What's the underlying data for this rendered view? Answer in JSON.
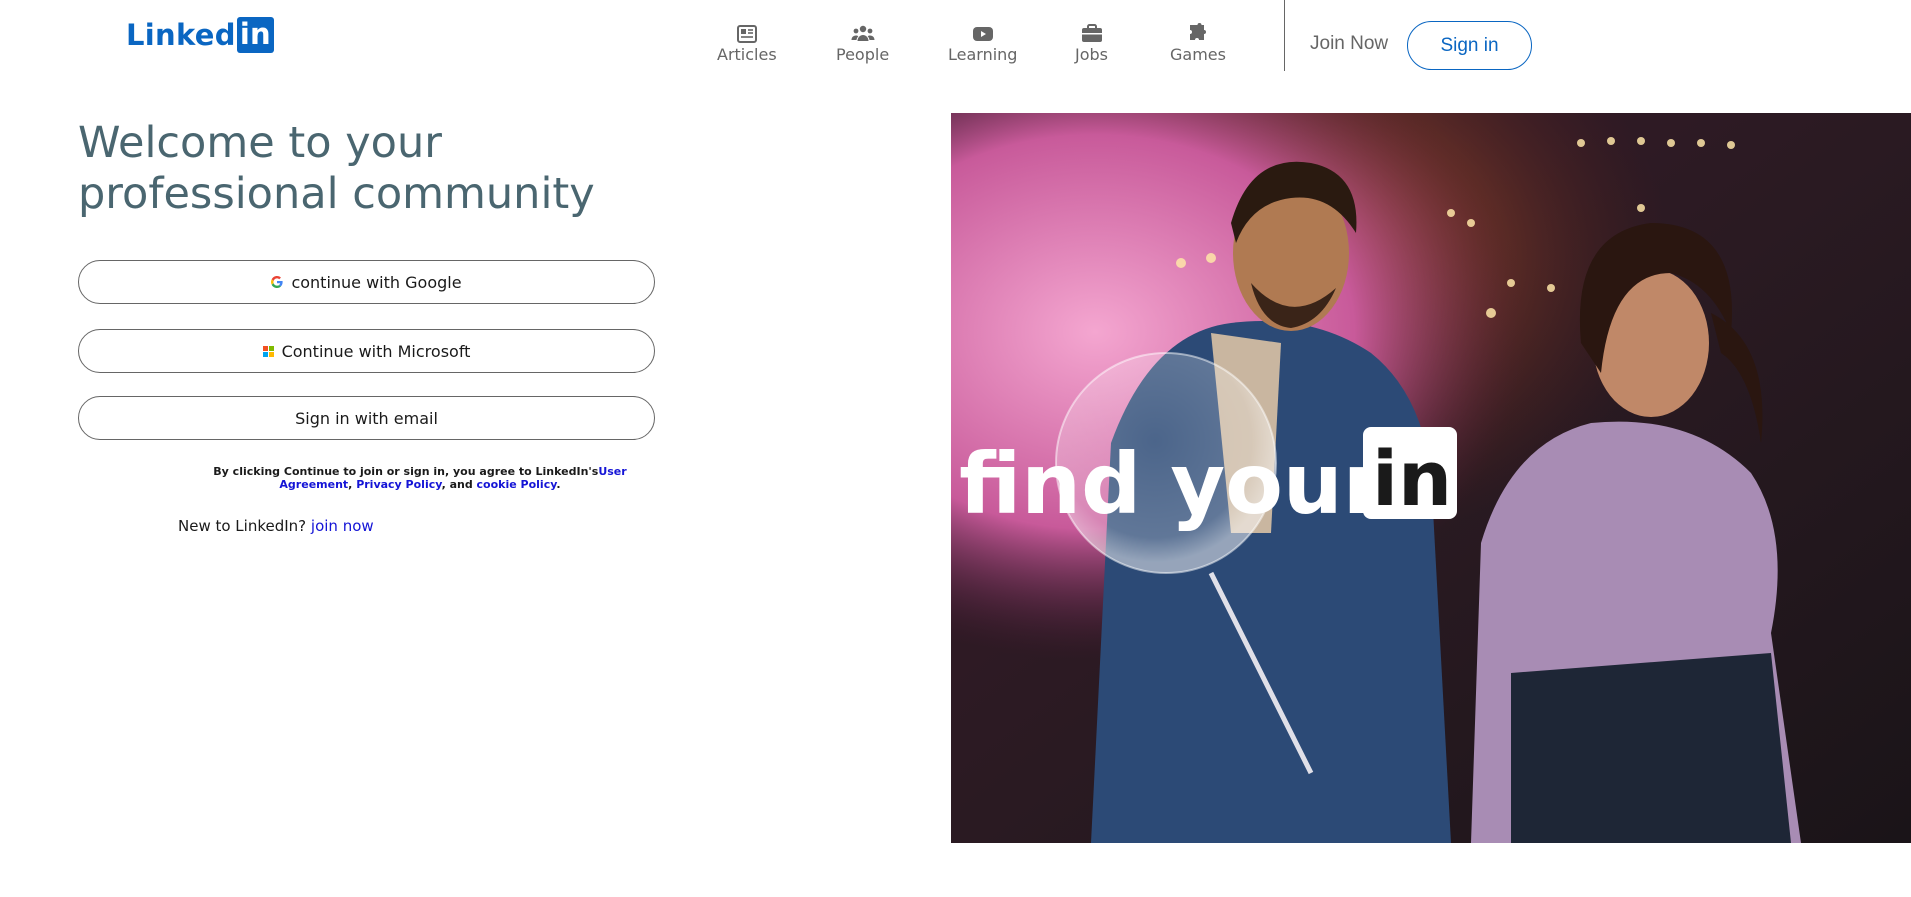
{
  "header": {
    "logo_text": "Linked",
    "logo_in": "in",
    "nav": [
      {
        "label": "Articles",
        "icon": "newspaper-icon"
      },
      {
        "label": "People",
        "icon": "people-icon"
      },
      {
        "label": "Learning",
        "icon": "play-video-icon"
      },
      {
        "label": "Jobs",
        "icon": "briefcase-icon"
      },
      {
        "label": "Games",
        "icon": "puzzle-piece-icon"
      }
    ],
    "join_now": "Join Now",
    "sign_in": "Sign in"
  },
  "main": {
    "headline": "Welcome to your professional community",
    "google_button": "continue with Google",
    "microsoft_button": "Continue with Microsoft",
    "email_button": "Sign in with email",
    "legal_prefix": "By clicking Continue to join or sign in, you agree to LinkedIn's",
    "legal_user_agreement": "User Agreement",
    "legal_sep1": ", ",
    "legal_privacy": "Privacy Policy",
    "legal_sep2": ", and ",
    "legal_cookie": "cookie Policy",
    "legal_end": ".",
    "new_to": "New to LinkedIn? ",
    "join_now_link": "join now"
  },
  "hero": {
    "tagline": "find your",
    "tagline_in": "in"
  },
  "colors": {
    "brand_blue": "#0a66c2",
    "headline": "#4a6670",
    "link": "#1414d6"
  }
}
